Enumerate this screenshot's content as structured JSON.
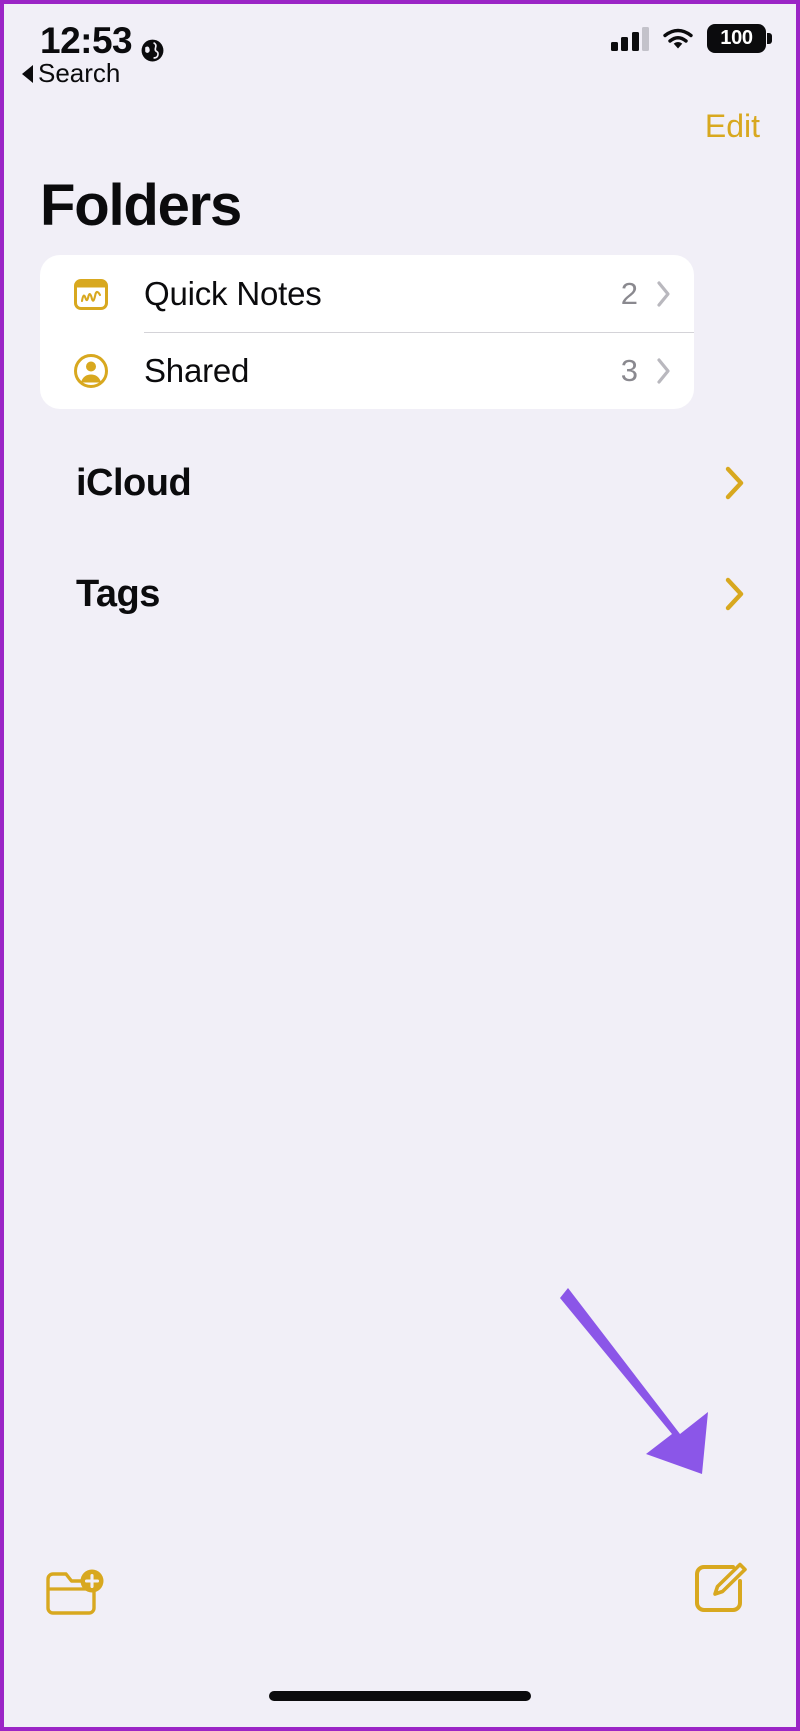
{
  "status_bar": {
    "time": "12:53",
    "location_icon": "globe-icon",
    "signal_icon": "cellular-signal-icon",
    "wifi_icon": "wifi-icon",
    "battery_level": "100",
    "battery_icon": "battery-full-icon"
  },
  "back_link": {
    "label": "Search",
    "icon": "back-triangle-icon"
  },
  "nav": {
    "edit_label": "Edit",
    "title": "Folders"
  },
  "folder_card": {
    "rows": [
      {
        "label": "Quick Notes",
        "count": "2",
        "icon": "quick-note-icon",
        "chevron": "chevron-right-icon"
      },
      {
        "label": "Shared",
        "count": "3",
        "icon": "shared-person-icon",
        "chevron": "chevron-right-icon"
      }
    ]
  },
  "sections": [
    {
      "label": "iCloud",
      "chevron": "chevron-right-icon"
    },
    {
      "label": "Tags",
      "chevron": "chevron-right-icon"
    }
  ],
  "toolbar": {
    "new_folder_icon": "new-folder-icon",
    "compose_icon": "compose-note-icon"
  },
  "annotation": {
    "arrow_icon": "pointer-arrow-icon",
    "arrow_color": "#8b56e8",
    "target": "compose-note-icon"
  },
  "colors": {
    "accent_gold": "#d8a81f",
    "page_background": "#f1eff7",
    "card_background": "#ffffff",
    "text_primary": "#0b0b0d",
    "text_secondary": "#8a898f",
    "border_purple": "#9b25c6"
  },
  "home_indicator": "home-indicator"
}
